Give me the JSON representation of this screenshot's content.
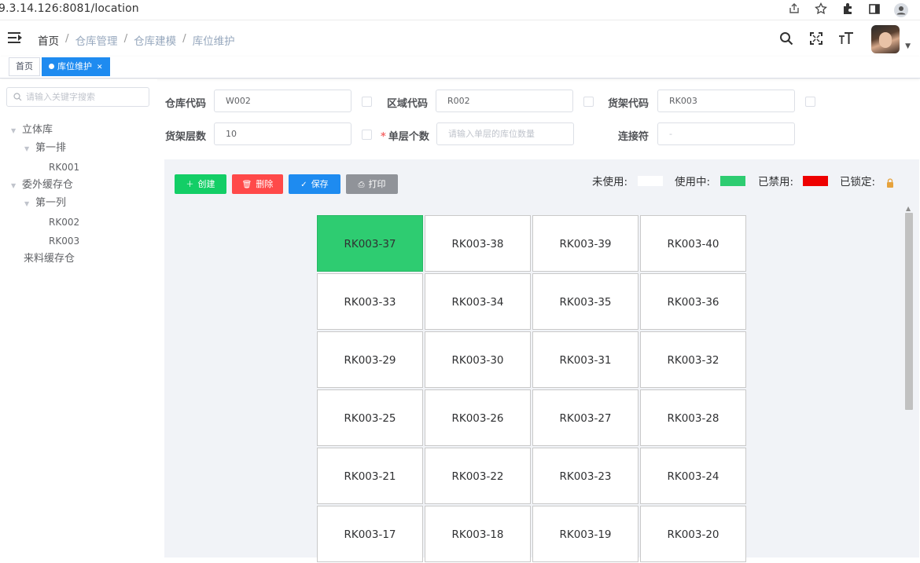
{
  "browser": {
    "url": "9.3.14.126:8081/location",
    "icons": [
      "share-icon",
      "star-icon",
      "extensions-icon",
      "sidebar-icon",
      "profile-icon"
    ]
  },
  "header": {
    "breadcrumb": [
      "首页",
      "仓库管理",
      "仓库建模",
      "库位维护"
    ],
    "icons": [
      "search-icon",
      "fullscreen-icon",
      "font-size-icon"
    ]
  },
  "tags": {
    "home": "首页",
    "active": "库位维护"
  },
  "tree": {
    "search_placeholder": "请输入关键字搜索",
    "nodes": [
      {
        "label": "立体库"
      },
      {
        "label": "第一排"
      },
      {
        "label": "RK001"
      },
      {
        "label": "委外缓存仓"
      },
      {
        "label": "第一列"
      },
      {
        "label": "RK002"
      },
      {
        "label": "RK003"
      },
      {
        "label": "来料缓存仓"
      }
    ]
  },
  "form": {
    "warehouse_code_label": "仓库代码",
    "warehouse_code_value": "W002",
    "area_code_label": "区域代码",
    "area_code_value": "R002",
    "shelf_code_label": "货架代码",
    "shelf_code_value": "RK003",
    "shelf_layers_label": "货架层数",
    "shelf_layers_value": "10",
    "per_layer_label": "单层个数",
    "per_layer_required": "*",
    "per_layer_placeholder": "请输入单层的库位数量",
    "connector_label": "连接符",
    "connector_value": "-"
  },
  "toolbar": {
    "create": "创建",
    "delete": "删除",
    "save": "保存",
    "print": "打印"
  },
  "legend": {
    "unused": "未使用:",
    "in_use": "使用中:",
    "disabled": "已禁用:",
    "locked": "已锁定:",
    "colors": {
      "unused": "#ffffff",
      "in_use": "#2ecc71",
      "disabled": "#ee0000",
      "locked": "#e6a23c"
    }
  },
  "locations": [
    {
      "code": "RK003-37",
      "status": "in_use"
    },
    {
      "code": "RK003-38",
      "status": "unused"
    },
    {
      "code": "RK003-39",
      "status": "unused"
    },
    {
      "code": "RK003-40",
      "status": "unused"
    },
    {
      "code": "RK003-33",
      "status": "unused"
    },
    {
      "code": "RK003-34",
      "status": "unused"
    },
    {
      "code": "RK003-35",
      "status": "unused"
    },
    {
      "code": "RK003-36",
      "status": "unused"
    },
    {
      "code": "RK003-29",
      "status": "unused"
    },
    {
      "code": "RK003-30",
      "status": "unused"
    },
    {
      "code": "RK003-31",
      "status": "unused"
    },
    {
      "code": "RK003-32",
      "status": "unused"
    },
    {
      "code": "RK003-25",
      "status": "unused"
    },
    {
      "code": "RK003-26",
      "status": "unused"
    },
    {
      "code": "RK003-27",
      "status": "unused"
    },
    {
      "code": "RK003-28",
      "status": "unused"
    },
    {
      "code": "RK003-21",
      "status": "unused"
    },
    {
      "code": "RK003-22",
      "status": "unused"
    },
    {
      "code": "RK003-23",
      "status": "unused"
    },
    {
      "code": "RK003-24",
      "status": "unused"
    },
    {
      "code": "RK003-17",
      "status": "unused"
    },
    {
      "code": "RK003-18",
      "status": "unused"
    },
    {
      "code": "RK003-19",
      "status": "unused"
    },
    {
      "code": "RK003-20",
      "status": "unused"
    }
  ]
}
